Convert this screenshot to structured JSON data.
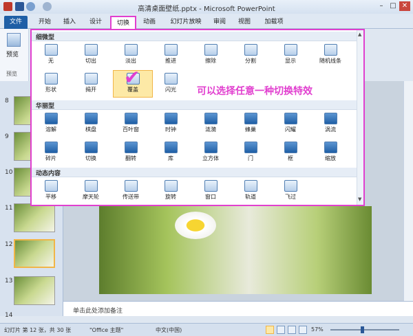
{
  "window": {
    "title": "高清桌面壁纸.pptx - Microsoft PowerPoint"
  },
  "tabs": [
    {
      "label": "文件"
    },
    {
      "label": "开始"
    },
    {
      "label": "插入"
    },
    {
      "label": "设计"
    },
    {
      "label": "切换"
    },
    {
      "label": "动画"
    },
    {
      "label": "幻灯片放映"
    },
    {
      "label": "审阅"
    },
    {
      "label": "视图"
    },
    {
      "label": "加载项"
    }
  ],
  "ribbon_left": {
    "preview_label": "预览",
    "group_label": "预览"
  },
  "gallery": {
    "categories": [
      {
        "title": "细微型",
        "items": [
          "无",
          "切出",
          "淡出",
          "推进",
          "擦除",
          "分割",
          "显示",
          "随机线条",
          "形状",
          "揭开",
          "覆盖",
          "闪光"
        ]
      },
      {
        "title": "华丽型",
        "items": [
          "溶解",
          "棋盘",
          "百叶窗",
          "时钟",
          "涟漪",
          "蜂巢",
          "闪耀",
          "涡流",
          "碎片",
          "切换",
          "翻转",
          "库",
          "立方体",
          "门",
          "框",
          "缩放"
        ]
      },
      {
        "title": "动态内容",
        "items": [
          "平移",
          "摩天轮",
          "传送带",
          "旋转",
          "窗口",
          "轨道",
          "飞过"
        ]
      }
    ],
    "annotation": "可以选择任意一种切换特效"
  },
  "slides": {
    "numbers": [
      "8",
      "9",
      "10",
      "11",
      "12",
      "13",
      "14"
    ]
  },
  "notes": {
    "placeholder": "单击此处添加备注"
  },
  "status": {
    "slide_info": "幻灯片 第 12 张，共 30 张",
    "theme": "\"Office 主题\"",
    "language": "中文(中国)",
    "zoom": "57%"
  },
  "colors": {
    "accent": "#e13fcf",
    "file_tab": "#1f5fa6"
  }
}
